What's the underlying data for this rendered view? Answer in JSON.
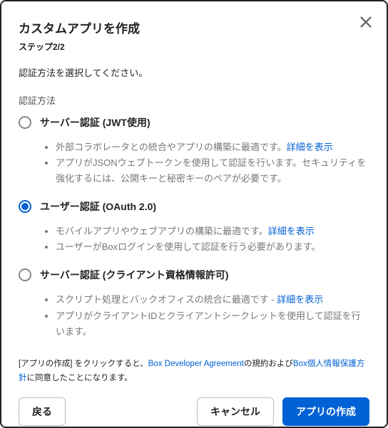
{
  "modal": {
    "title": "カスタムアプリを作成",
    "step": "ステップ2/2",
    "instruction": "認証方法を選択してください。",
    "section_label": "認証方法"
  },
  "options": [
    {
      "id": "jwt",
      "title": "サーバー認証 (JWT使用)",
      "selected": false,
      "bullets": [
        {
          "text": "外部コラボレータとの統合やアプリの構築に最適です。",
          "link": "詳細を表示"
        },
        {
          "text": "アプリがJSONウェブトークンを使用して認証を行います。セキュリティを強化するには、公開キーと秘密キーのペアが必要です。"
        }
      ]
    },
    {
      "id": "oauth",
      "title": "ユーザー認証 (OAuth 2.0)",
      "selected": true,
      "bullets": [
        {
          "text": "モバイルアプリやウェブアプリの構築に最適です。",
          "link": "詳細を表示"
        },
        {
          "text": "ユーザーがBoxログインを使用して認証を行う必要があります。"
        }
      ]
    },
    {
      "id": "ccg",
      "title": "サーバー認証 (クライアント資格情報許可)",
      "selected": false,
      "bullets": [
        {
          "text": "スクリプト処理とバックオフィスの統合に最適です - ",
          "link": "詳細を表示"
        },
        {
          "text": "アプリがクライアントIDとクライアントシークレットを使用して認証を行います。"
        }
      ]
    }
  ],
  "agreement": {
    "prefix": "[アプリの作成] をクリックすると、",
    "link1": "Box Developer Agreement",
    "mid": "の規約および",
    "link2": "Box個人情報保護方針",
    "suffix": "に同意したことになります。"
  },
  "buttons": {
    "back": "戻る",
    "cancel": "キャンセル",
    "create": "アプリの作成"
  }
}
